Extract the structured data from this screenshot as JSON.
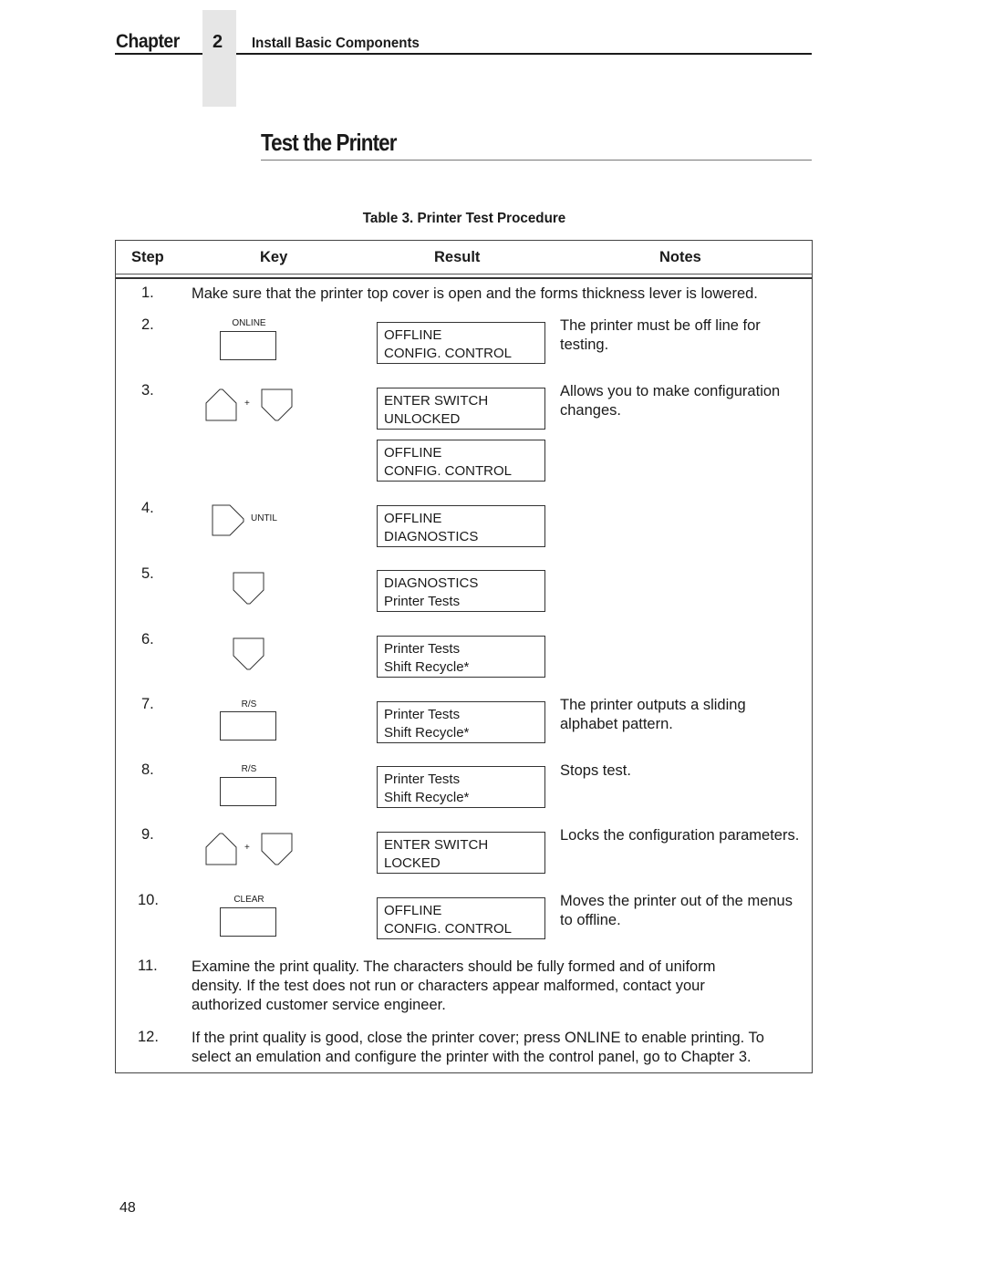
{
  "header": {
    "chapter_word": "Chapter",
    "chapter_number": "2",
    "chapter_title": "Install Basic Components"
  },
  "section": {
    "title": "Test the Printer"
  },
  "table": {
    "caption": "Table 3. Printer Test Procedure",
    "columns": [
      "Step",
      "Key",
      "Result",
      "Notes"
    ],
    "rows": [
      {
        "step": "1.",
        "text": "Make sure that the printer top cover is open and the forms thickness lever is lowered."
      },
      {
        "step": "2.",
        "key": {
          "type": "button",
          "label": "ONLINE"
        },
        "results": [
          [
            "OFFLINE",
            "CONFIG. CONTROL"
          ]
        ],
        "note": "The printer must be off line for testing."
      },
      {
        "step": "3.",
        "key": {
          "type": "up-plus-down",
          "plus": "+"
        },
        "results": [
          [
            "ENTER SWITCH",
            "UNLOCKED"
          ],
          [
            "OFFLINE",
            "CONFIG. CONTROL"
          ]
        ],
        "note": "Allows you to make configuration changes."
      },
      {
        "step": "4.",
        "key": {
          "type": "right-arrow",
          "suffix": "UNTIL"
        },
        "results": [
          [
            "OFFLINE",
            "DIAGNOSTICS"
          ]
        ],
        "note": ""
      },
      {
        "step": "5.",
        "key": {
          "type": "down-arrow"
        },
        "results": [
          [
            "DIAGNOSTICS",
            "Printer Tests"
          ]
        ],
        "note": ""
      },
      {
        "step": "6.",
        "key": {
          "type": "down-arrow"
        },
        "results": [
          [
            "Printer Tests",
            "Shift Recycle*"
          ]
        ],
        "note": ""
      },
      {
        "step": "7.",
        "key": {
          "type": "button",
          "label": "R/S"
        },
        "results": [
          [
            "Printer Tests",
            "Shift Recycle*"
          ]
        ],
        "note": "The printer outputs a sliding alphabet pattern."
      },
      {
        "step": "8.",
        "key": {
          "type": "button",
          "label": "R/S"
        },
        "results": [
          [
            "Printer Tests",
            "Shift Recycle*"
          ]
        ],
        "note": "Stops test."
      },
      {
        "step": "9.",
        "key": {
          "type": "up-plus-down",
          "plus": "+"
        },
        "results": [
          [
            "ENTER SWITCH",
            "LOCKED"
          ]
        ],
        "note": "Locks the configuration parameters."
      },
      {
        "step": "10.",
        "key": {
          "type": "button",
          "label": "CLEAR"
        },
        "results": [
          [
            "OFFLINE",
            "CONFIG. CONTROL"
          ]
        ],
        "note": "Moves the printer out of the menus to offline."
      },
      {
        "step": "11.",
        "text_lines": [
          "Examine the print quality. The characters should be fully formed and of uniform",
          "density. If the test does not run or characters appear malformed, contact your",
          "authorized customer service engineer."
        ]
      },
      {
        "step": "12.",
        "text_lines": [
          "If the print quality is good, close the printer cover; press ONLINE to enable printing. To",
          "select an emulation and configure the printer with the control panel, go to Chapter 3."
        ]
      }
    ]
  },
  "footer": {
    "page_number": "48"
  }
}
